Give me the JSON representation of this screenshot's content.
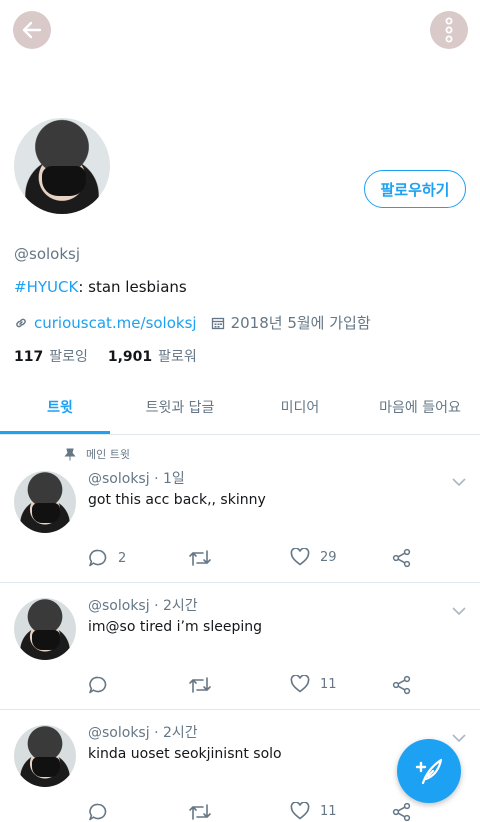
{
  "profile": {
    "handle": "@soloksj",
    "bio_tag": "#HYUCK",
    "bio_text": ": stan lesbians",
    "link": "curiouscat.me/soloksj",
    "joined": "2018년 5월에 가입함",
    "following_count": "117",
    "following_label": "팔로잉",
    "followers_count": "1,901",
    "followers_label": "팔로워",
    "follow_button": "팔로우하기"
  },
  "tabs": [
    "트윗",
    "트윗과 답글",
    "미디어",
    "마음에 들어요"
  ],
  "pinned_label": "메인 트윗",
  "tweets": [
    {
      "handle": "@soloksj",
      "sep": "·",
      "time": "1일",
      "text": "got this acc back,, skinny",
      "replies": "2",
      "likes": "29"
    },
    {
      "handle": "@soloksj",
      "sep": "·",
      "time": "2시간",
      "text": "im@so tired i’m sleeping",
      "replies": "",
      "likes": "11"
    },
    {
      "handle": "@soloksj",
      "sep": "·",
      "time": "2시간",
      "text": "kinda uoset seokjinisnt solo",
      "replies": "",
      "likes": "11"
    }
  ],
  "colors": {
    "accent": "#1da1f2",
    "muted": "#657786",
    "text": "#14171a",
    "header_btn": "#d9c9c9"
  },
  "icons": [
    "back-arrow-icon",
    "more-vertical-icon",
    "link-icon",
    "calendar-icon",
    "pin-icon",
    "chevron-down-icon",
    "reply-icon",
    "retweet-icon",
    "heart-icon",
    "share-icon",
    "compose-icon"
  ]
}
